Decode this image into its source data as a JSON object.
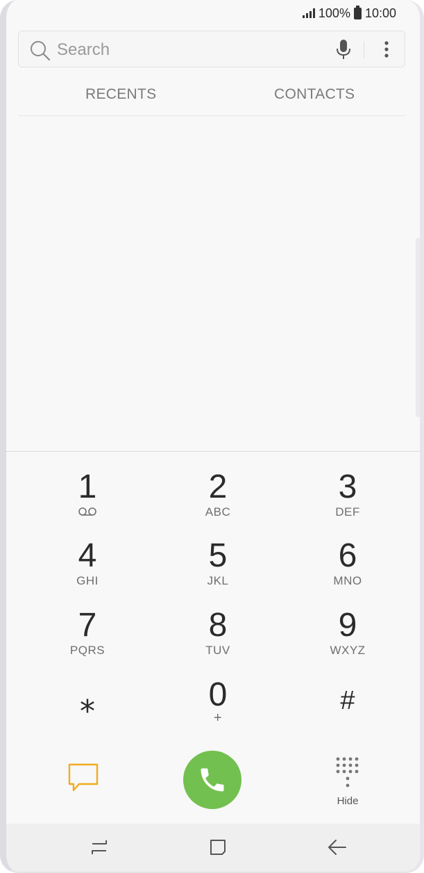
{
  "status_bar": {
    "battery": "100%",
    "time": "10:00"
  },
  "search": {
    "placeholder": "Search"
  },
  "tabs": [
    {
      "label": "RECENTS"
    },
    {
      "label": "CONTACTS"
    }
  ],
  "keypad": {
    "keys": [
      {
        "digit": "1",
        "sub": ""
      },
      {
        "digit": "2",
        "sub": "ABC"
      },
      {
        "digit": "3",
        "sub": "DEF"
      },
      {
        "digit": "4",
        "sub": "GHI"
      },
      {
        "digit": "5",
        "sub": "JKL"
      },
      {
        "digit": "6",
        "sub": "MNO"
      },
      {
        "digit": "7",
        "sub": "PQRS"
      },
      {
        "digit": "8",
        "sub": "TUV"
      },
      {
        "digit": "9",
        "sub": "WXYZ"
      },
      {
        "digit": "⁎",
        "sub": ""
      },
      {
        "digit": "0",
        "sub": "+"
      },
      {
        "digit": "#",
        "sub": ""
      }
    ]
  },
  "actions": {
    "hide_label": "Hide"
  },
  "colors": {
    "call_green": "#72c04f",
    "message_orange": "#f0ac1e"
  }
}
